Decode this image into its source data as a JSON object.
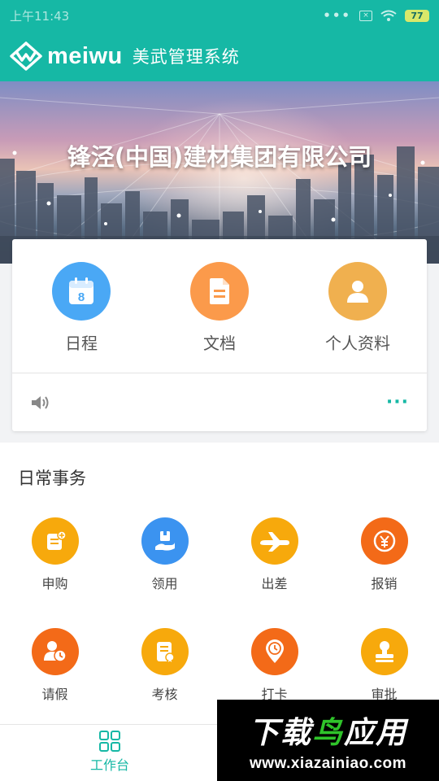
{
  "status_bar": {
    "time": "上午11:43",
    "battery": "77"
  },
  "app_bar": {
    "brand": "meiwu",
    "title": "美武管理系统"
  },
  "banner": {
    "company": "锋泾(中国)建材集团有限公司"
  },
  "quick_actions": [
    {
      "label": "日程",
      "icon": "calendar-icon",
      "color": "#4aa8f5"
    },
    {
      "label": "文档",
      "icon": "document-icon",
      "color": "#fb9a4b"
    },
    {
      "label": "个人资料",
      "icon": "person-icon",
      "color": "#f0b04f"
    }
  ],
  "notice": {
    "more": "···"
  },
  "daily": {
    "title": "日常事务",
    "items": [
      {
        "label": "申购",
        "icon": "purchase-icon",
        "color": "#f7a90c"
      },
      {
        "label": "领用",
        "icon": "receive-icon",
        "color": "#3b93f0"
      },
      {
        "label": "出差",
        "icon": "airplane-icon",
        "color": "#f7a90c"
      },
      {
        "label": "报销",
        "icon": "reimburse-icon",
        "color": "#f36a18"
      },
      {
        "label": "请假",
        "icon": "leave-icon",
        "color": "#f36a18"
      },
      {
        "label": "考核",
        "icon": "assessment-icon",
        "color": "#f7a90c"
      },
      {
        "label": "打卡",
        "icon": "clock-in-icon",
        "color": "#f36a18"
      },
      {
        "label": "审批",
        "icon": "approve-icon",
        "color": "#f7a90c"
      }
    ]
  },
  "bottom_nav": {
    "workbench": "工作台"
  },
  "watermark": {
    "title_a": "下载",
    "title_b": "鸟",
    "title_c": "应用",
    "url": "www.xiazainiao.com"
  },
  "colors": {
    "primary": "#16b8a5"
  }
}
